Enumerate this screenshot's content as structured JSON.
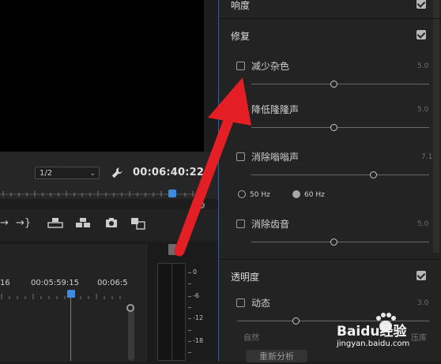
{
  "monitor": {
    "fit_value": "1/2",
    "timecode": "00:06:40:22"
  },
  "timeline": {
    "times": [
      "16",
      "00:05:59:15",
      "00:06:5"
    ]
  },
  "meter": {
    "labels": [
      "0",
      "-6",
      "-12",
      "-18"
    ]
  },
  "panel": {
    "section_top": "响度",
    "repair": {
      "title": "修复",
      "items": [
        {
          "label": "减少杂色",
          "value": "5.0"
        },
        {
          "label": "降低隆隆声",
          "value": "5.0"
        },
        {
          "label": "消除嗡嗡声",
          "value": "7.1"
        },
        {
          "label": "消除齿音",
          "value": "5.0"
        }
      ],
      "hz_50": "50 Hz",
      "hz_60": "60 Hz"
    },
    "clarity": {
      "title": "透明度",
      "dynamics_label": "动态",
      "dynamics_value": "3.0",
      "auto_label": "自然",
      "reanalyze": "重新分析",
      "right_label": "压库"
    }
  },
  "watermark": {
    "brand": "Baidu经验",
    "url": "jingyan.baidu.com"
  },
  "colors": {
    "accent_blue": "#3d8be0",
    "arrow_red": "#e31e24"
  }
}
